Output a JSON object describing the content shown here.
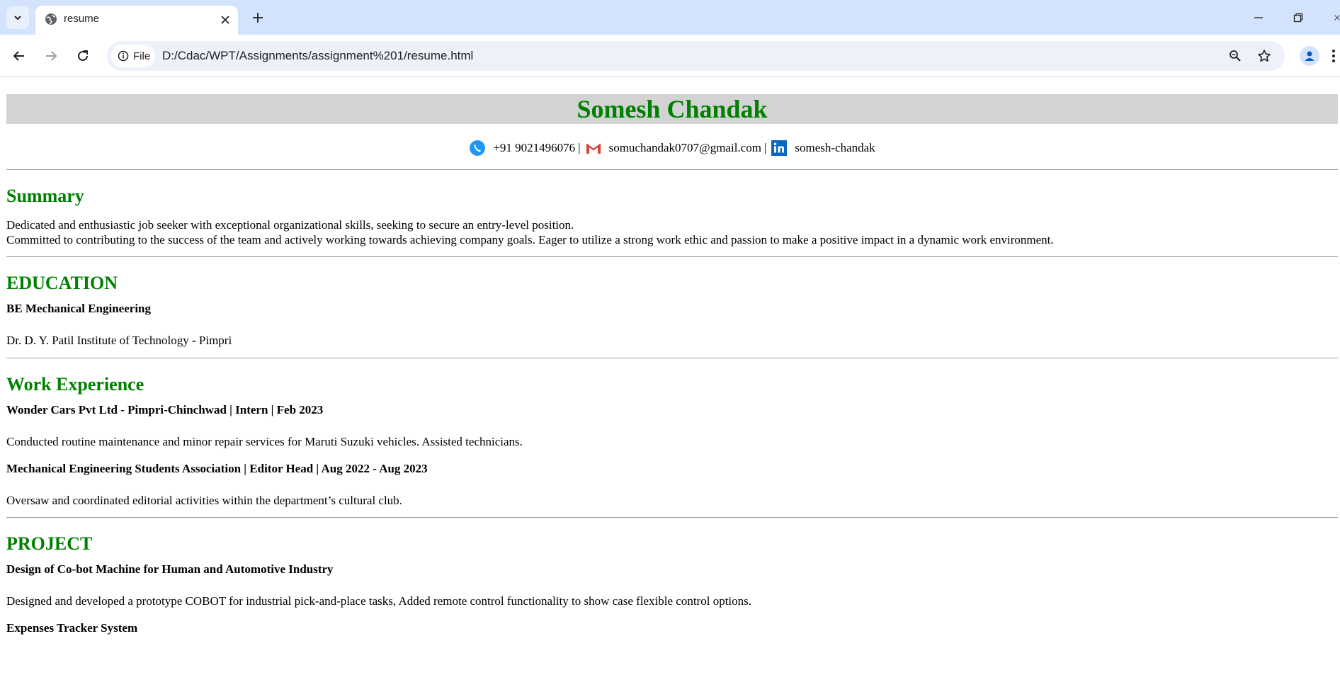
{
  "browser": {
    "tab_title": "resume",
    "site_info_label": "File",
    "url": "D:/Cdac/WPT/Assignments/assignment%201/resume.html"
  },
  "resume": {
    "name": "Somesh Chandak",
    "contact": {
      "phone": "+91 9021496076",
      "email": "somuchandak0707@gmail.com",
      "linkedin": "somesh-chandak",
      "separator": "|"
    },
    "summary": {
      "heading": "Summary",
      "line1": "Dedicated and enthusiastic job seeker with exceptional organizational skills, seeking to secure an entry-level position.",
      "line2": "Committed to contributing to the success of the team and actively working towards achieving company goals. Eager to utilize a strong work ethic and passion to make a positive impact in a dynamic work environment."
    },
    "education": {
      "heading": "EDUCATION",
      "degree": "BE Mechanical Engineering",
      "institute": "Dr. D. Y. Patil Institute of Technology",
      "dash": " - ",
      "location": "Pimpri"
    },
    "experience": {
      "heading": "Work Experience",
      "items": [
        {
          "title": "Wonder Cars Pvt Ltd - Pimpri-Chinchwad | Intern | Feb 2023",
          "description": "Conducted routine maintenance and minor repair services for Maruti Suzuki vehicles. Assisted technicians."
        },
        {
          "title": "Mechanical Engineering Students Association | Editor Head | Aug 2022 - Aug 2023",
          "description": "Oversaw and coordinated editorial activities within the department’s cultural club."
        }
      ]
    },
    "project": {
      "heading": "PROJECT",
      "items": [
        {
          "title": "Design of Co-bot Machine for Human and Automotive Industry",
          "description": "Designed and developed a prototype COBOT for industrial pick-and-place tasks, Added remote control functionality to show case flexible control options."
        },
        {
          "title": "Expenses Tracker System"
        }
      ]
    }
  }
}
